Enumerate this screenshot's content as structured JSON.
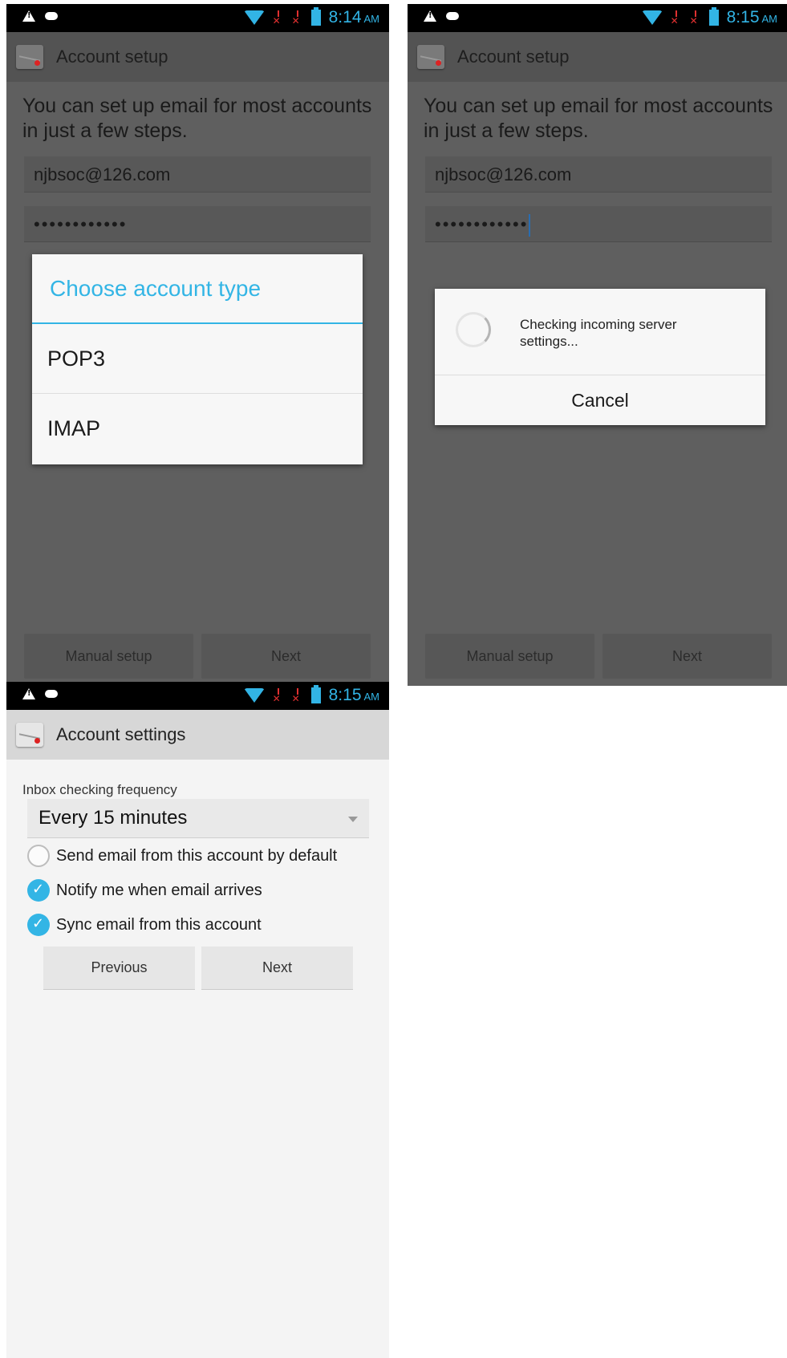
{
  "screen1": {
    "status": {
      "time": "8:14",
      "ampm": "AM"
    },
    "title": "Account setup",
    "intro": "You can set up email for most accounts in just a few steps.",
    "email": "njbsoc@126.com",
    "password": "••••••••••••",
    "dialog": {
      "title": "Choose account type",
      "options": [
        "POP3",
        "IMAP"
      ]
    },
    "buttons": {
      "manual": "Manual setup",
      "next": "Next"
    }
  },
  "screen2": {
    "status": {
      "time": "8:15",
      "ampm": "AM"
    },
    "title": "Account setup",
    "intro": "You can set up email for most accounts in just a few steps.",
    "email": "njbsoc@126.com",
    "password": "••••••••••••",
    "progress": {
      "message": "Checking incoming server settings...",
      "cancel": "Cancel"
    },
    "buttons": {
      "manual": "Manual setup",
      "next": "Next"
    }
  },
  "screen3": {
    "status": {
      "time": "8:15",
      "ampm": "AM"
    },
    "title": "Account settings",
    "frequency": {
      "label": "Inbox checking frequency",
      "value": "Every 15 minutes"
    },
    "options": [
      {
        "label": "Send email from this account by default",
        "checked": false
      },
      {
        "label": "Notify me when email arrives",
        "checked": true
      },
      {
        "label": "Sync email from this account",
        "checked": true
      }
    ],
    "buttons": {
      "previous": "Previous",
      "next": "Next"
    }
  },
  "colors": {
    "accent": "#33b5e5",
    "dim_background": "#5f5f5f",
    "settings_background": "#f4f4f4"
  },
  "icons": [
    "warning-icon",
    "chat-icon",
    "wifi-icon",
    "no-signal-icon",
    "battery-icon",
    "email-app-icon",
    "spinner-arrow-icon",
    "check-icon"
  ]
}
